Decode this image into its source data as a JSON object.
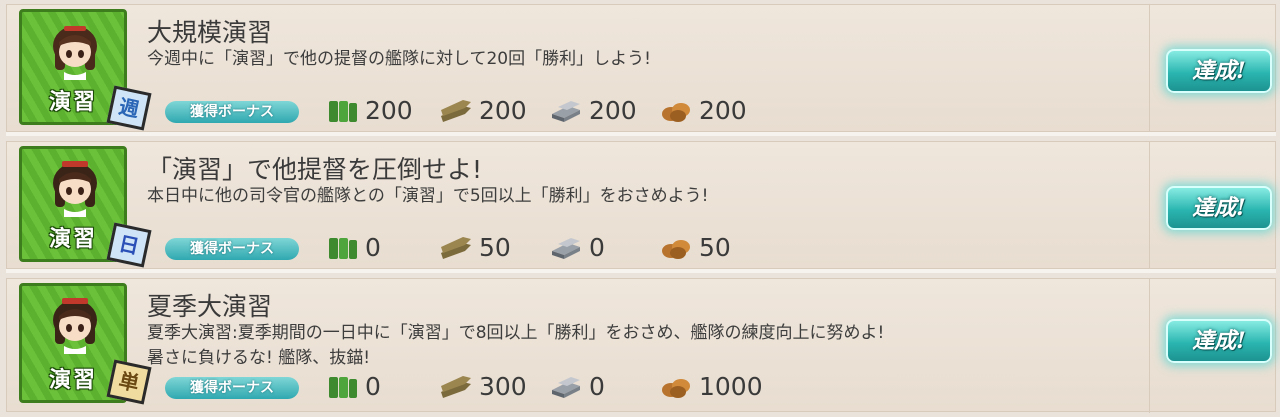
{
  "bonus_label": "獲得ボーナス",
  "achieved_label": "達成!",
  "category_label": "演習",
  "colors": {
    "achieved_button": "#2ab5b0",
    "category_green": "#6cc13a",
    "bonus_teal": "#2fa8b0"
  },
  "icons": [
    "fuel-icon",
    "ammo-icon",
    "steel-icon",
    "bauxite-icon"
  ],
  "quests": [
    {
      "frequency": "週",
      "title": "大規模演習",
      "description": "今週中に「演習」で他の提督の艦隊に対して20回「勝利」しよう!",
      "rewards": {
        "fuel": "200",
        "ammo": "200",
        "steel": "200",
        "bauxite": "200"
      }
    },
    {
      "frequency": "日",
      "title": "「演習」で他提督を圧倒せよ!",
      "description": "本日中に他の司令官の艦隊との「演習」で5回以上「勝利」をおさめよう!",
      "rewards": {
        "fuel": "0",
        "ammo": "50",
        "steel": "0",
        "bauxite": "50"
      }
    },
    {
      "frequency": "単",
      "title": "夏季大演習",
      "description": "夏季大演習:夏季期間の一日中に「演習」で8回以上「勝利」をおさめ、艦隊の練度向上に努めよ!\n暑さに負けるな! 艦隊、抜錨!",
      "rewards": {
        "fuel": "0",
        "ammo": "300",
        "steel": "0",
        "bauxite": "1000"
      }
    }
  ]
}
